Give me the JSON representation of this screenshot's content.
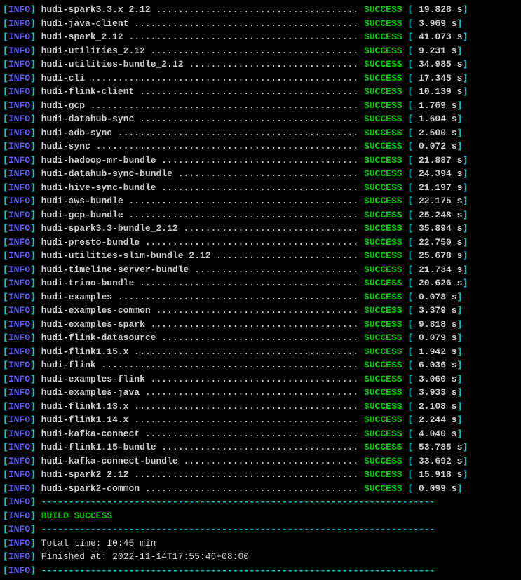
{
  "info_tag": "INFO",
  "success_text": "SUCCESS",
  "modules": [
    {
      "name": "hudi-spark3.3.x_2.12",
      "time": "19.828"
    },
    {
      "name": "hudi-java-client",
      "time": "3.969"
    },
    {
      "name": "hudi-spark_2.12",
      "time": "41.073"
    },
    {
      "name": "hudi-utilities_2.12",
      "time": "9.231"
    },
    {
      "name": "hudi-utilities-bundle_2.12",
      "time": "34.985"
    },
    {
      "name": "hudi-cli",
      "time": "17.345"
    },
    {
      "name": "hudi-flink-client",
      "time": "10.139"
    },
    {
      "name": "hudi-gcp",
      "time": "1.769"
    },
    {
      "name": "hudi-datahub-sync",
      "time": "1.604"
    },
    {
      "name": "hudi-adb-sync",
      "time": "2.500"
    },
    {
      "name": "hudi-sync",
      "time": "0.072"
    },
    {
      "name": "hudi-hadoop-mr-bundle",
      "time": "21.887"
    },
    {
      "name": "hudi-datahub-sync-bundle",
      "time": "24.394"
    },
    {
      "name": "hudi-hive-sync-bundle",
      "time": "21.197"
    },
    {
      "name": "hudi-aws-bundle",
      "time": "22.175"
    },
    {
      "name": "hudi-gcp-bundle",
      "time": "25.248"
    },
    {
      "name": "hudi-spark3.3-bundle_2.12",
      "time": "35.894"
    },
    {
      "name": "hudi-presto-bundle",
      "time": "22.750"
    },
    {
      "name": "hudi-utilities-slim-bundle_2.12",
      "time": "25.678"
    },
    {
      "name": "hudi-timeline-server-bundle",
      "time": "21.734"
    },
    {
      "name": "hudi-trino-bundle",
      "time": "20.626"
    },
    {
      "name": "hudi-examples",
      "time": "0.078"
    },
    {
      "name": "hudi-examples-common",
      "time": "3.379"
    },
    {
      "name": "hudi-examples-spark",
      "time": "9.818"
    },
    {
      "name": "hudi-flink-datasource",
      "time": "0.079"
    },
    {
      "name": "hudi-flink1.15.x",
      "time": "1.942"
    },
    {
      "name": "hudi-flink",
      "time": "6.036"
    },
    {
      "name": "hudi-examples-flink",
      "time": "3.060"
    },
    {
      "name": "hudi-examples-java",
      "time": "3.933"
    },
    {
      "name": "hudi-flink1.13.x",
      "time": "2.108"
    },
    {
      "name": "hudi-flink1.14.x",
      "time": "2.244"
    },
    {
      "name": "hudi-kafka-connect",
      "time": "4.040"
    },
    {
      "name": "hudi-flink1.15-bundle",
      "time": "53.785"
    },
    {
      "name": "hudi-kafka-connect-bundle",
      "time": "33.692"
    },
    {
      "name": "hudi-spark2_2.12",
      "time": "15.918"
    },
    {
      "name": "hudi-spark2-common",
      "time": "0.099"
    }
  ],
  "separator": "------------------------------------------------------------------------",
  "build_status": "BUILD SUCCESS",
  "total_time_label": "Total time:",
  "total_time_value": "10:45 min",
  "finished_at_label": "Finished at:",
  "finished_at_value": "2022-11-14T17:55:46+08:00"
}
